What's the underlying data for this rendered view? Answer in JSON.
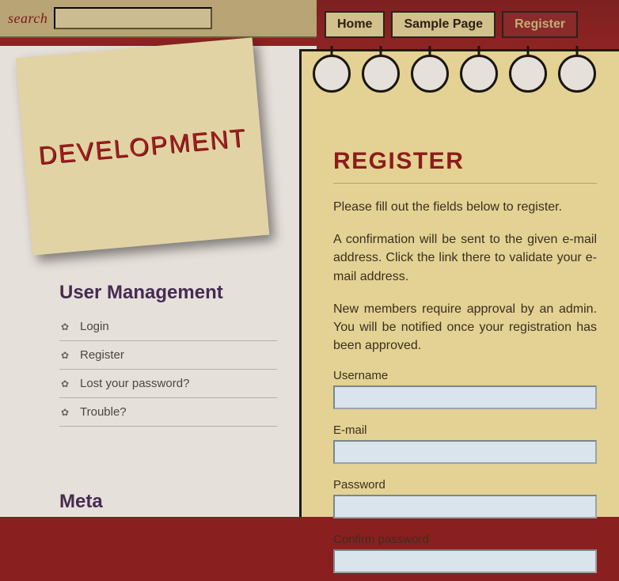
{
  "header": {
    "search_label": "search",
    "search_value": ""
  },
  "nav": {
    "items": [
      {
        "label": "Home",
        "active": false
      },
      {
        "label": "Sample Page",
        "active": false
      },
      {
        "label": "Register",
        "active": true
      }
    ]
  },
  "sticky": {
    "title": "DEVELOPMENT"
  },
  "sidebar": {
    "section1_title": "User Management",
    "items": [
      {
        "label": "Login"
      },
      {
        "label": "Register"
      },
      {
        "label": "Lost your password?"
      },
      {
        "label": "Trouble?"
      }
    ],
    "section2_title": "Meta"
  },
  "page": {
    "title": "REGISTER",
    "intro1": "Please fill out the fields below to register.",
    "intro2": "A confirmation will be sent to the given e-mail address. Click the link there to validate your e-mail address.",
    "intro3": "New members require approval by an admin. You will be notified once your registration has been approved.",
    "fields": {
      "username_label": "Username",
      "email_label": "E-mail",
      "password_label": "Password",
      "confirm_label": "Confirm password"
    }
  }
}
